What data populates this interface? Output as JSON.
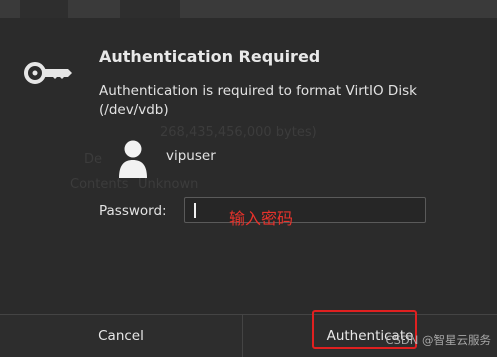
{
  "dialog": {
    "title": "Authentication Required",
    "message": "Authentication is required to format VirtIO Disk (/dev/vdb)",
    "user": "vipuser",
    "password_label": "Password:",
    "password_value": "",
    "annotation": "输入密码",
    "cancel_label": "Cancel",
    "authenticate_label": "Authenticate"
  },
  "icons": {
    "key": "key-icon",
    "user": "user-avatar-icon"
  },
  "colors": {
    "annotation": "#e8322b",
    "highlight_border": "#e02020"
  },
  "background": {
    "ghost_size_text": "268,435,456,000 bytes)",
    "ghost_label_1": "De",
    "ghost_label_2": "Contents",
    "ghost_value_2": "Unknown"
  },
  "watermark": "CSDN @智星云服务"
}
